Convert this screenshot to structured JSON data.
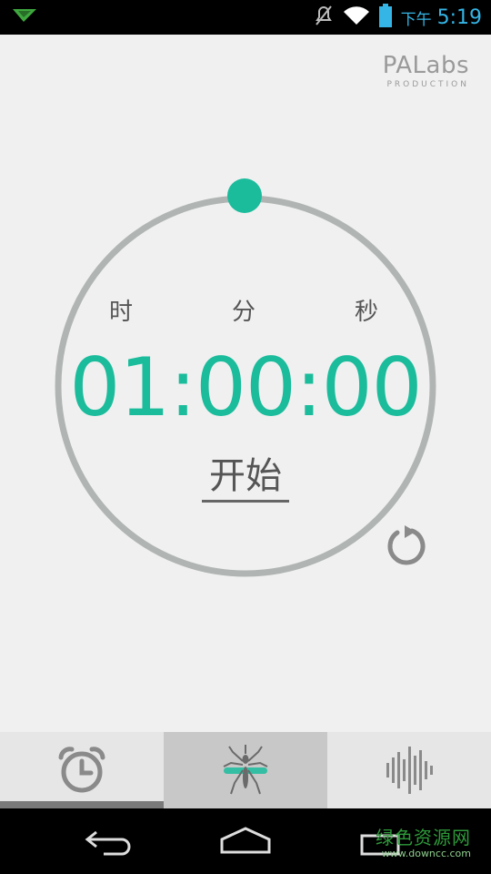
{
  "status_bar": {
    "ampm": "下午",
    "time": "5:19"
  },
  "brand": {
    "name": "PALabs",
    "sub": "PRODUCTION"
  },
  "timer": {
    "units": {
      "hour": "时",
      "minute": "分",
      "second": "秒"
    },
    "display": "01:00:00",
    "start_label": "开始"
  },
  "tabs": [
    {
      "icon": "alarm-clock-icon",
      "active": false
    },
    {
      "icon": "mosquito-icon",
      "active": true
    },
    {
      "icon": "soundwave-icon",
      "active": false
    }
  ],
  "watermark": {
    "line1": "绿色资源网",
    "line2": "www.downcc.com"
  },
  "colors": {
    "accent": "#1abc9c",
    "ring": "#b0b5b3",
    "status": "#35b5e5"
  }
}
